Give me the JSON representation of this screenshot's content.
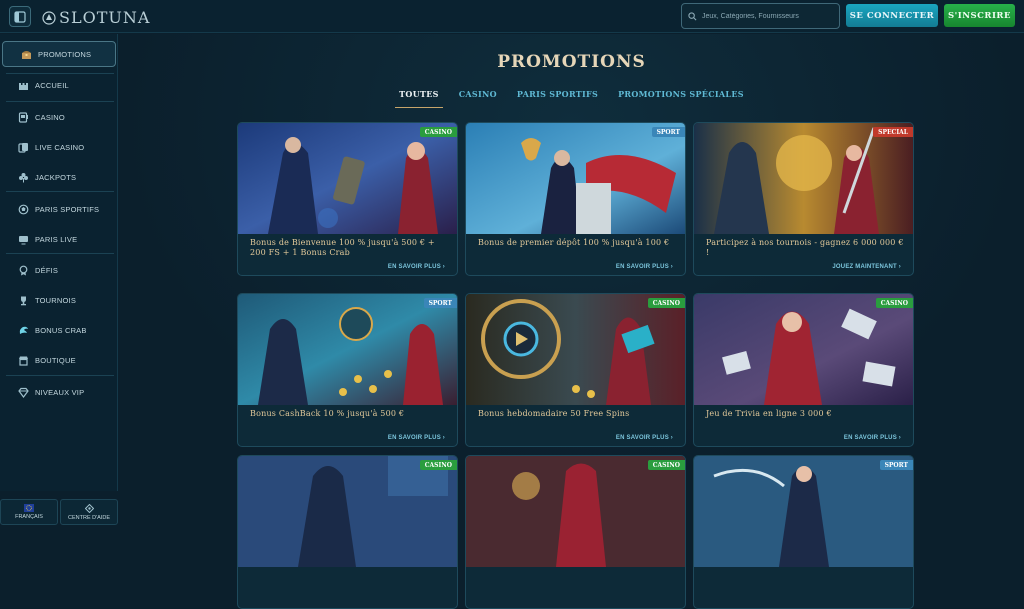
{
  "header": {
    "logo_text": "SLOTUNA",
    "search_placeholder": "Jeux, Catégories, Fournisseurs",
    "login_label": "SE CONNECTER",
    "register_label": "S'INSCRIRE"
  },
  "sidebar": {
    "items": [
      {
        "label": "PROMOTIONS",
        "icon": "treasure-chest-icon"
      },
      {
        "label": "ACCUEIL",
        "icon": "castle-icon"
      },
      {
        "label": "CASINO",
        "icon": "slot-machine-icon"
      },
      {
        "label": "LIVE CASINO",
        "icon": "cards-icon"
      },
      {
        "label": "JACKPOTS",
        "icon": "clover-icon"
      },
      {
        "label": "PARIS SPORTIFS",
        "icon": "ball-icon"
      },
      {
        "label": "PARIS LIVE",
        "icon": "screen-icon"
      },
      {
        "label": "DÉFIS",
        "icon": "medal-icon"
      },
      {
        "label": "TOURNOIS",
        "icon": "trophy-icon"
      },
      {
        "label": "BONUS CRAB",
        "icon": "claw-icon"
      },
      {
        "label": "BOUTIQUE",
        "icon": "shop-icon"
      },
      {
        "label": "NIVEAUX VIP",
        "icon": "diamond-icon"
      }
    ],
    "footer": {
      "language": "FRANÇAIS",
      "help": "CENTRE D'AIDE"
    }
  },
  "main": {
    "title": "PROMOTIONS",
    "tabs": [
      "TOUTES",
      "CASINO",
      "PARIS SPORTIFS",
      "PROMOTIONS SPÉCIALES"
    ],
    "active_tab": "TOUTES",
    "cards": [
      {
        "badge": "CASINO",
        "title": "Bonus de Bienvenue 100 % jusqu'à 500 € + 200 FS + 1 Bonus Crab",
        "link": "EN SAVOIR PLUS ›"
      },
      {
        "badge": "SPORT",
        "title": "Bonus de premier dépôt 100 % jusqu'à 100 €",
        "link": "EN SAVOIR PLUS ›"
      },
      {
        "badge": "SPECIAL",
        "title": "Participez à nos tournois - gagnez 6 000 000 € !",
        "link": "JOUEZ MAINTENANT ›"
      },
      {
        "badge": "SPORT",
        "title": "Bonus CashBack 10 % jusqu'à 500 €",
        "link": "EN SAVOIR PLUS ›"
      },
      {
        "badge": "CASINO",
        "title": "Bonus hebdomadaire 50 Free Spins",
        "link": "EN SAVOIR PLUS ›"
      },
      {
        "badge": "CASINO",
        "title": "Jeu de Trivia en ligne 3 000 €",
        "link": "EN SAVOIR PLUS ›"
      },
      {
        "badge": "CASINO",
        "title": "",
        "link": ""
      },
      {
        "badge": "CASINO",
        "title": "",
        "link": ""
      },
      {
        "badge": "SPORT",
        "title": "",
        "link": ""
      }
    ]
  },
  "colors": {
    "casino_badge": "#2a9d3e",
    "sport_badge": "#3a86b8",
    "special_badge": "#c0392b",
    "accent_gold": "#e2c99a",
    "accent_cyan": "#1aa6c0",
    "register_green": "#27b04a"
  }
}
